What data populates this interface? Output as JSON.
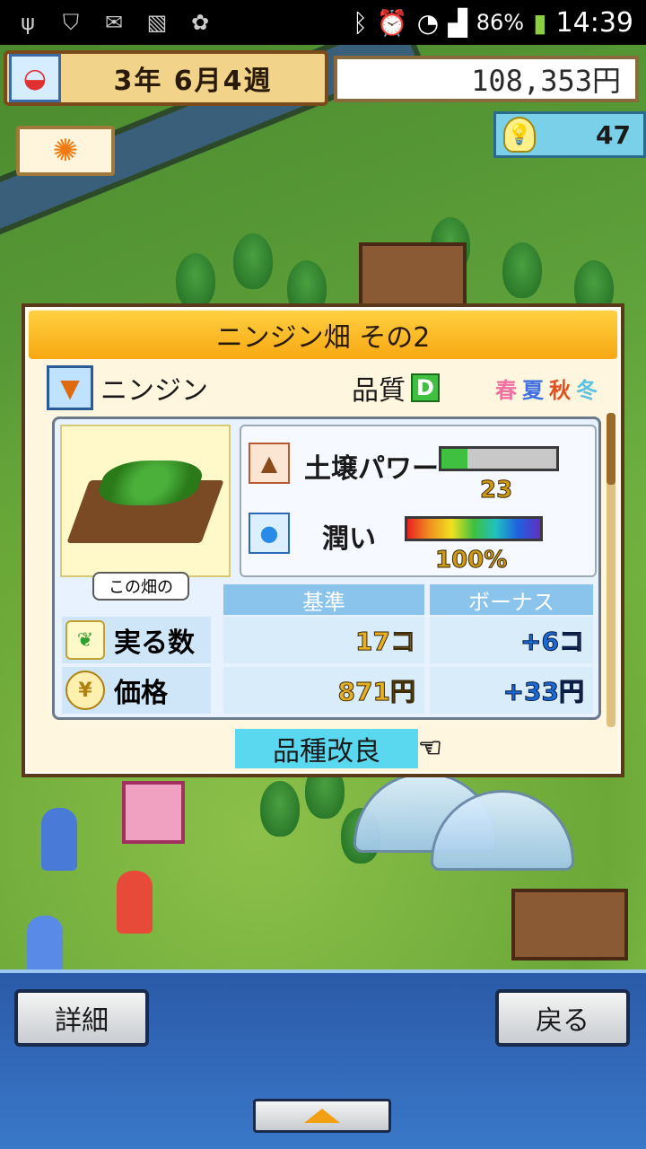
{
  "status_bar": {
    "battery": "86%",
    "time": "14:39"
  },
  "hud": {
    "date": "3年 6月4週",
    "money": "108,353円",
    "ideas_count": "47"
  },
  "dialog": {
    "title": "ニンジン畑 その2",
    "crop_name": "ニンジン",
    "quality_label": "品質",
    "quality_grade": "D",
    "seasons": [
      {
        "label": "春",
        "color": "#f070a0"
      },
      {
        "label": "夏",
        "color": "#4070e0"
      },
      {
        "label": "秋",
        "color": "#e05020"
      },
      {
        "label": "冬",
        "color": "#60c0e0"
      }
    ],
    "field_tag": "この畑の",
    "soil_label": "土壌パワー",
    "soil_value": "23",
    "soil_level": 0.23,
    "moisture_label": "潤い",
    "moisture_value": "100%",
    "table": {
      "headers": [
        "基準",
        "ボーナス"
      ],
      "rows": [
        {
          "label": "実る数",
          "base": "17コ",
          "bonus": "+6コ"
        },
        {
          "label": "価格",
          "base": "871円",
          "bonus": "+33円"
        }
      ]
    },
    "improve_button": "品種改良"
  },
  "bottom": {
    "details_button": "詳細",
    "back_button": "戻る"
  }
}
